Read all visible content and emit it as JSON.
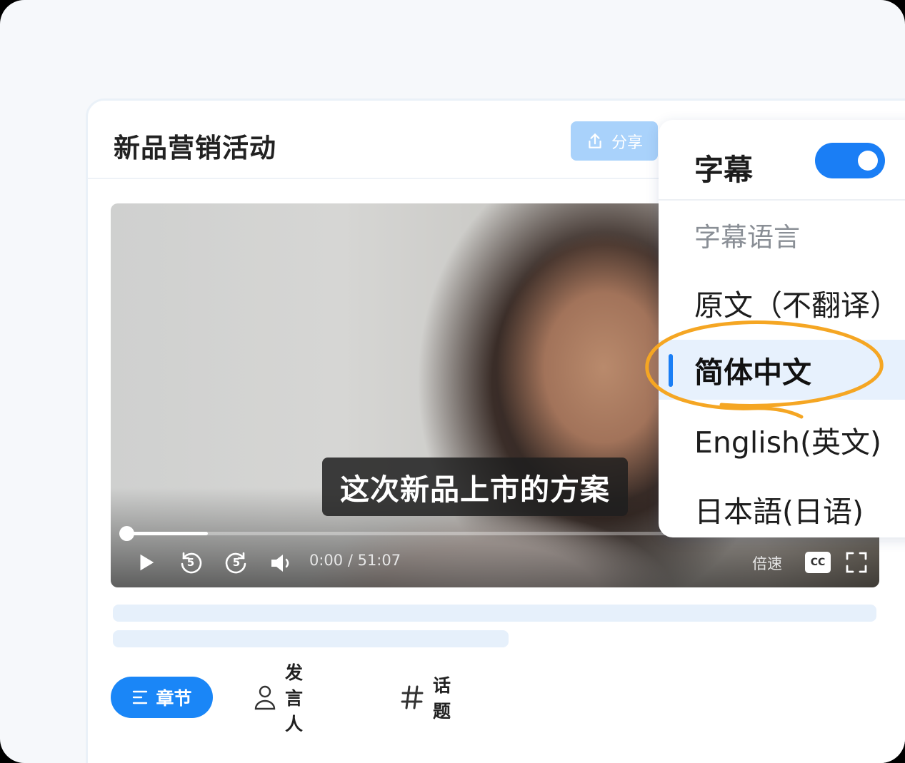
{
  "card": {
    "title": "新品营销活动",
    "share_label": "分享"
  },
  "video": {
    "subtitle": "这次新品上市的方案",
    "progress": 0.11,
    "time": "0:00 / 51:07",
    "rewind_seconds": "5",
    "forward_seconds": "5",
    "speed_label": "倍速",
    "cc_label": "CC"
  },
  "tabs": [
    {
      "label": "章节",
      "active": true
    },
    {
      "label": "发言人",
      "active": false
    },
    {
      "label": "话题",
      "active": false
    }
  ],
  "subtitle_panel": {
    "toggle_label": "字幕",
    "toggle_on": true,
    "section_label": "字幕语言",
    "languages": [
      {
        "label": "原文（不翻译）",
        "selected": false
      },
      {
        "label": "简体中文",
        "selected": true
      },
      {
        "label": "English(英文)",
        "selected": false
      },
      {
        "label": "日本語(日语)",
        "selected": false
      }
    ]
  },
  "colors": {
    "accent": "#1a7ef5",
    "highlight_ring": "#f5a623",
    "share_button": "#a9d2fb"
  }
}
